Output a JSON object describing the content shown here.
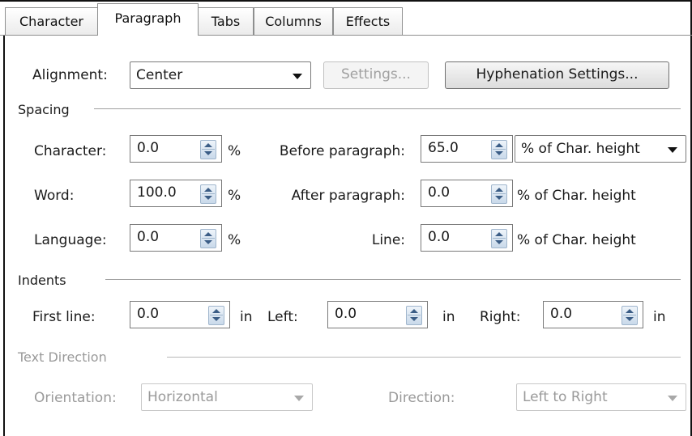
{
  "tabs": [
    {
      "label": "Character"
    },
    {
      "label": "Paragraph",
      "active": true
    },
    {
      "label": "Tabs"
    },
    {
      "label": "Columns"
    },
    {
      "label": "Effects"
    }
  ],
  "alignment": {
    "label": "Alignment:",
    "value": "Center",
    "settings_button": "Settings...",
    "hyphenation_button": "Hyphenation Settings..."
  },
  "spacing": {
    "section_label": "Spacing",
    "character": {
      "label": "Character:",
      "value": "0.0",
      "unit": "%"
    },
    "word": {
      "label": "Word:",
      "value": "100.0",
      "unit": "%"
    },
    "language": {
      "label": "Language:",
      "value": "0.0",
      "unit": "%"
    },
    "before_paragraph": {
      "label": "Before paragraph:",
      "value": "65.0",
      "unit_selected": "% of Char. height"
    },
    "after_paragraph": {
      "label": "After paragraph:",
      "value": "0.0",
      "unit": "% of Char. height"
    },
    "line": {
      "label": "Line:",
      "value": "0.0",
      "unit": "% of Char. height"
    }
  },
  "indents": {
    "section_label": "Indents",
    "first_line": {
      "label": "First line:",
      "value": "0.0",
      "unit": "in"
    },
    "left": {
      "label": "Left:",
      "value": "0.0",
      "unit": "in"
    },
    "right": {
      "label": "Right:",
      "value": "0.0",
      "unit": "in"
    }
  },
  "text_direction": {
    "section_label": "Text Direction",
    "orientation": {
      "label": "Orientation:",
      "value": "Horizontal"
    },
    "direction": {
      "label": "Direction:",
      "value": "Left to Right"
    }
  },
  "colors": {
    "disabled_text": "#9a9a9a",
    "spin_accent": "#3b5d86",
    "border": "#7a7a7a"
  }
}
